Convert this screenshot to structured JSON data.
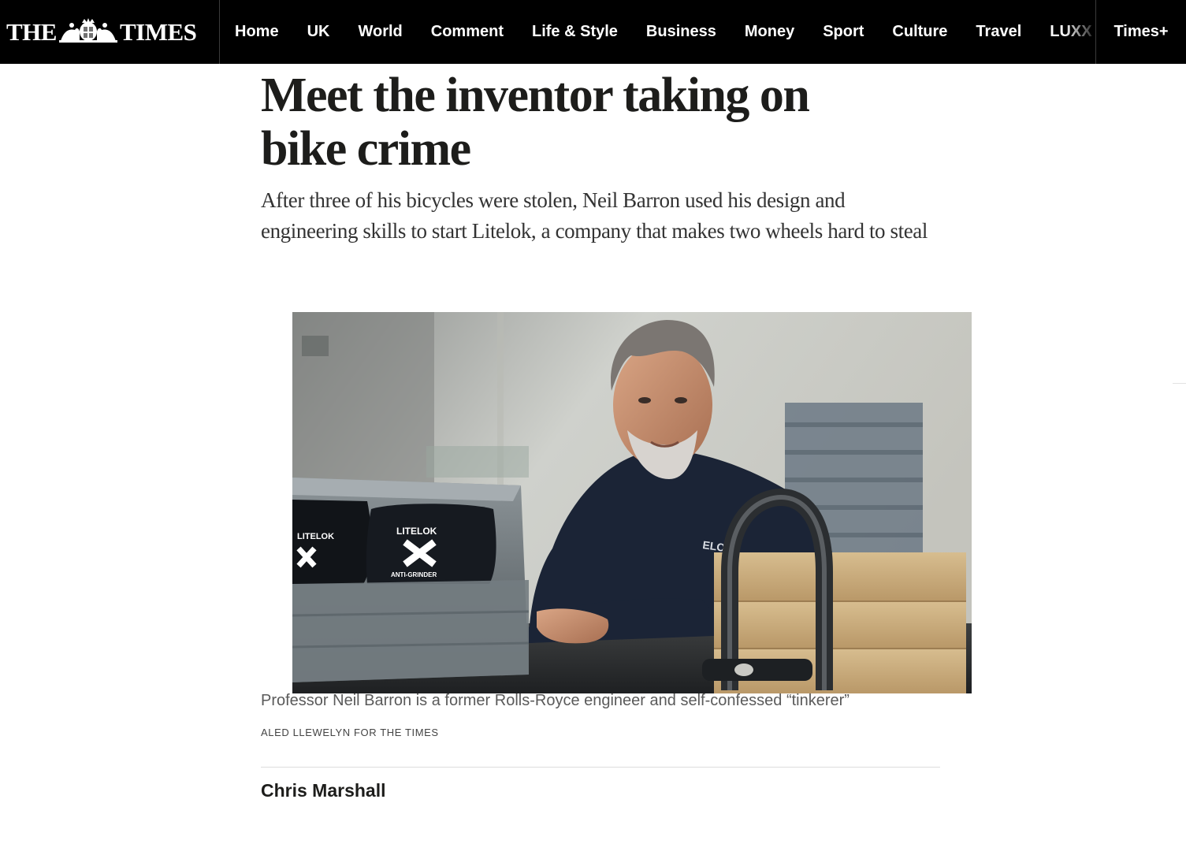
{
  "masthead": {
    "logo_left": "THE",
    "logo_right": "TIMES",
    "crest_icon": "royal-crest-icon"
  },
  "nav": {
    "items": [
      "Home",
      "UK",
      "World",
      "Comment",
      "Life & Style",
      "Business",
      "Money",
      "Sport",
      "Culture",
      "Travel",
      "LUXX"
    ],
    "times_plus": "Times+"
  },
  "article": {
    "headline": "Meet the inventor taking on bike crime",
    "standfirst": "After three of his bicycles were stolen, Neil Barron used his design and engineering skills to start Litelok, a company that makes two wheels hard to steal",
    "image": {
      "caption": "Professor Neil Barron is a former Rolls-Royce engineer and self-confessed “tinkerer”",
      "credit": "ALED LLEWELYN FOR THE TIMES",
      "product_text": [
        "LITELOK",
        "ANTI-GRINDER",
        "LITELOK",
        "ELOK"
      ]
    },
    "byline": "Chris Marshall"
  },
  "colors": {
    "nav_background": "#000000",
    "nav_text": "#ffffff",
    "headline": "#1d1d1b",
    "standfirst": "#333333",
    "caption": "#5a5a5a",
    "divider": "#dcdcdc"
  }
}
